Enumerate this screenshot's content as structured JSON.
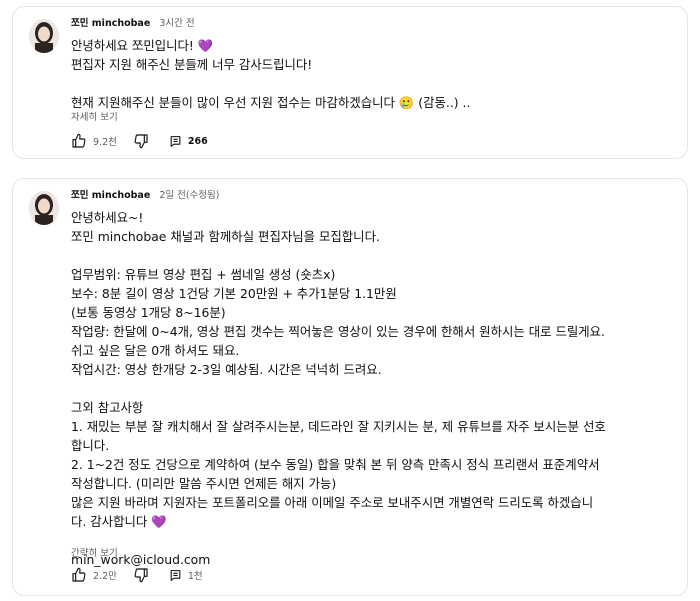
{
  "comments": [
    {
      "author": "쪼민 minchobae",
      "time": "3시간 전",
      "lines": [
        "안녕하세요 쪼민입니다! ",
        "편집자 지원 해주신 분들께 너무 감사드립니다!",
        "",
        "현재 지원해주신 분들이 많이 우선 지원 접수는 마감하겠습니다 🥲 (감동..) .."
      ],
      "heart_glyph": "💜",
      "more_label": "자세히 보기",
      "likes": "9.2천",
      "replies": "266"
    },
    {
      "author": "쪼민 minchobae",
      "time": "2일 전(수정됨)",
      "lines": [
        "안녕하세요~!",
        "쪼민 minchobae 채널과 함께하실 편집자님을 모집합니다.",
        "",
        "업무범위: 유튜브 영상 편집 + 썸네일 생성 (숏츠x)",
        "보수: 8분 길이 영상 1건당 기본 20만원 + 추가1분당 1.1만원",
        "(보통 동영상 1개당 8~16분)",
        "작업량: 한달에 0~4개, 영상 편집 갯수는 찍어놓은 영상이 있는 경우에 한해서 원하시는 대로 드릴게요.",
        "쉬고 싶은 달은 0개 하셔도 돼요.",
        "작업시간: 영상 한개당 2-3일 예상됨. 시간은 넉넉히 드려요.",
        "",
        "그외 참고사항",
        "1. 재밌는 부분 잘 캐치해서 잘 살려주시는분, 데드라인 잘 지키시는 분, 제 유튜브를 자주 보시는분 선호",
        "합니다.",
        "2. 1~2건 정도 건당으로 계약하여 (보수 동일) 합을 맞춰 본 뒤 양측 만족시 정식 프리랜서 표준계약서",
        "작성합니다. (미리만 말씀 주시면 언제든 해지 가능)",
        "많은 지원 바라며 지원자는 포트폴리오를 아래 이메일 주소로 보내주시면 개별연락 드리도록 하겠습니",
        "다. 감사합니다 ",
        "",
        "min_work@icloud.com"
      ],
      "heart_glyph": "💜",
      "more_label": "간략히 보기",
      "likes": "2.2만",
      "replies": "1천"
    }
  ],
  "icons": [
    "thumbs-up-icon",
    "thumbs-down-icon",
    "comments-icon"
  ],
  "colors": {
    "heart": "#7b5cd6",
    "meta": "#606060",
    "border": "#e5e5e5"
  }
}
